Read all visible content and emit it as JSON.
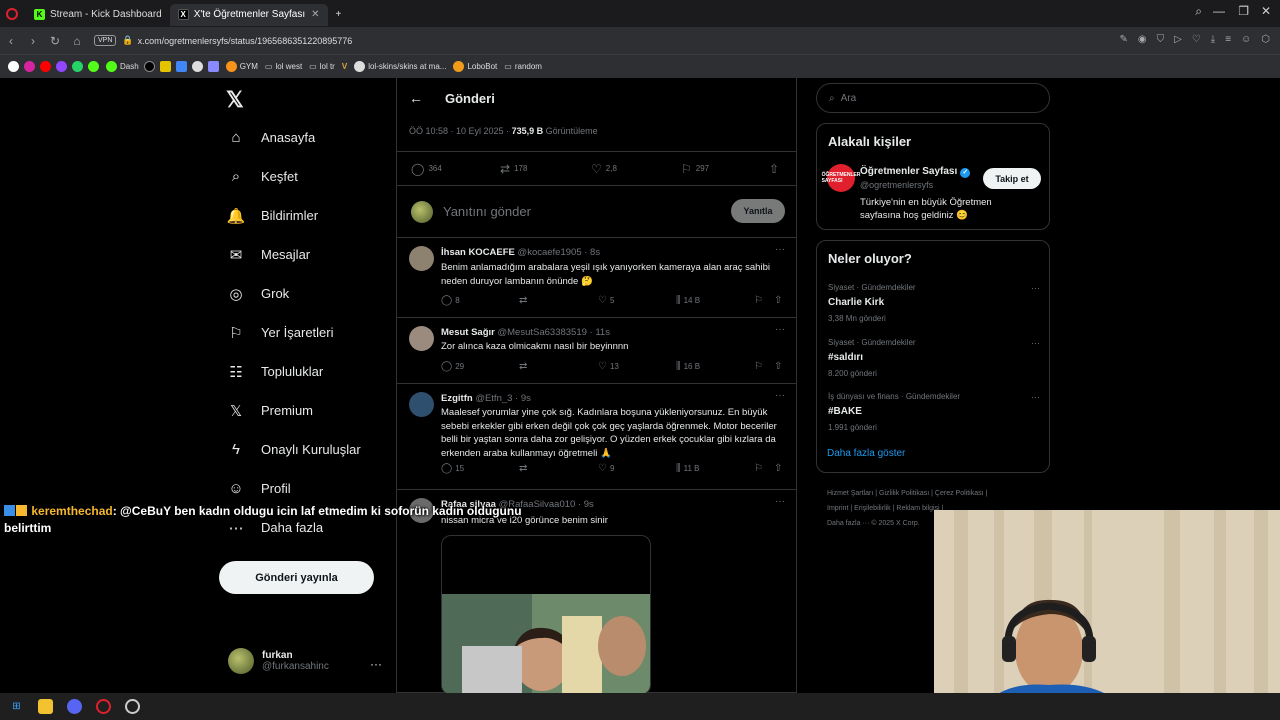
{
  "browser": {
    "tabs": [
      {
        "label": "Stream - Kick Dashboard",
        "icon": "kick-icon",
        "color": "#53fc18"
      },
      {
        "label": "X'te Öğretmenler Sayfası",
        "icon": "x-icon",
        "color": "#ffffff"
      }
    ],
    "new_tab": "+",
    "url": "x.com/ogretmenlersyfs/status/1965686351220895776",
    "vpn_label": "VPN",
    "bookmarks": [
      "Dash",
      "GYM",
      "lol west",
      "lol tr",
      "lol-skins/skins at ma...",
      "LoboBot",
      "random"
    ]
  },
  "left_nav": {
    "items": [
      {
        "label": "Anasayfa",
        "icon": "home-icon",
        "glyph": "⌂"
      },
      {
        "label": "Keşfet",
        "icon": "search-icon",
        "glyph": "⌕"
      },
      {
        "label": "Bildirimler",
        "icon": "bell-icon",
        "glyph": "🔔"
      },
      {
        "label": "Mesajlar",
        "icon": "mail-icon",
        "glyph": "✉"
      },
      {
        "label": "Grok",
        "icon": "grok-icon",
        "glyph": "◎"
      },
      {
        "label": "Yer İşaretleri",
        "icon": "bookmark-icon",
        "glyph": "⚐"
      },
      {
        "label": "Topluluklar",
        "icon": "communities-icon",
        "glyph": "☷"
      },
      {
        "label": "Premium",
        "icon": "x-premium-icon",
        "glyph": "𝕏"
      },
      {
        "label": "Onaylı Kuruluşlar",
        "icon": "lightning-icon",
        "glyph": "ϟ"
      },
      {
        "label": "Profil",
        "icon": "profile-icon",
        "glyph": "☺"
      },
      {
        "label": "Daha fazla",
        "icon": "more-icon",
        "glyph": "⋯"
      }
    ],
    "post_button": "Gönderi yayınla",
    "account": {
      "name": "furkan",
      "handle": "@furkansahinc"
    }
  },
  "main": {
    "title": "Gönderi",
    "meta_time": "ÖÖ 10:58 · 10 Eyl 2025 · ",
    "meta_views": "735,9 B",
    "meta_views_label": " Görüntüleme",
    "stats": {
      "replies": "364",
      "reposts": "178",
      "likes": "2,8",
      "bookmarks": "297"
    },
    "reply_placeholder": "Yanıtını gönder",
    "reply_button": "Yanıtla",
    "replies": [
      {
        "name": "İhsan KOCAEFE",
        "handle": "@kocaefe1905 · 8s",
        "text": "Benim anlamadığım arabalara yeşil ışık yanıyorken kameraya alan araç sahibi neden duruyor lambanın önünde 🤔",
        "replies": "8",
        "reposts": "",
        "likes": "5",
        "views": "14 B"
      },
      {
        "name": "Mesut Sağır",
        "handle": "@MesutSa63383519 · 11s",
        "text": "Zor alınca kaza olmicakmı nasıl bir beyinnnn",
        "replies": "29",
        "reposts": "",
        "likes": "13",
        "views": "16 B"
      },
      {
        "name": "Ezgitfn",
        "handle": "@Etfn_3 · 9s",
        "text": "Maalesef yorumlar yine çok sığ. Kadınlara boşuna yükleniyorsunuz. En büyük sebebi erkekler gibi erken değil çok çok geç yaşlarda öğrenmek. Motor beceriler belli bir yaştan sonra daha zor gelişiyor. O yüzden erkek çocuklar gibi kızlara da erkenden araba kullanmayı öğretmeli 🙏",
        "replies": "15",
        "reposts": "",
        "likes": "9",
        "views": "11 B"
      },
      {
        "name": "Rafaa silvaa",
        "handle": "@RafaaSilvaa010 · 9s",
        "text": "nissan micra ve i20 görünce benim sinir"
      }
    ]
  },
  "right": {
    "search_placeholder": "Ara",
    "relevant_title": "Alakalı kişiler",
    "person": {
      "name": "Öğretmenler Sayfası",
      "handle": "@ogretmenlersyfs",
      "bio": "Türkiye'nin en büyük Öğretmen sayfasına hoş geldiniz 😊",
      "follow": "Takip et",
      "avatar_text": "ÖĞRETMENLER SAYFASI"
    },
    "trends_title": "Neler oluyor?",
    "trends": [
      {
        "category": "Siyaset · Gündemdekiler",
        "title": "Charlie Kirk",
        "count": "3,38 Mn gönderi"
      },
      {
        "category": "Siyaset · Gündemdekiler",
        "title": "#saldırı",
        "count": "8.200 gönderi"
      },
      {
        "category": "İş dünyası ve finans · Gündemdekiler",
        "title": "#BAKE",
        "count": "1.991 gönderi"
      }
    ],
    "show_more": "Daha fazla göster",
    "footer": [
      "Hizmet Şartları",
      "Gizlilik Politikası",
      "Çerez Politikası",
      "Imprint",
      "Erişilebilirlik",
      "Reklam bilgisi",
      "Daha fazla ···",
      "© 2025 X Corp."
    ]
  },
  "chat": {
    "user": "keremthechad",
    "message": ": @CeBuY ben kadın oldugu icin laf etmedim ki soforün kadın oldugunu belirttim"
  },
  "colors": {
    "accent": "#1d9bf0",
    "background": "#000000",
    "border": "#2f3336",
    "muted": "#71767b"
  }
}
